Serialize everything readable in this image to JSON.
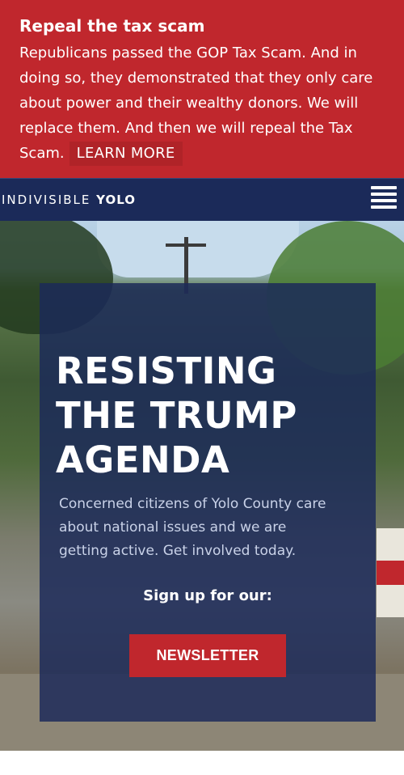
{
  "banner": {
    "title": "Repeal the tax scam",
    "body": "Republicans passed the GOP Tax Scam. And in doing so, they demonstrated that they only care about power and their wealthy donors. We will replace them. And then we will repeal the Tax Scam.",
    "learn_more": "LEARN MORE"
  },
  "nav": {
    "brand_part1": "INDIVISIBLE",
    "brand_part2": "YOLO",
    "menu_icon": "hamburger-menu-icon"
  },
  "hero": {
    "headline": "RESISTING THE TRUMP AGENDA",
    "description": "Concerned citizens of Yolo County care about national issues and we are getting active. Get involved today.",
    "signup_label": "Sign up for our:",
    "newsletter_button": "NEWSLETTER"
  },
  "colors": {
    "banner_red": "#c0272d",
    "navy": "#1b2a59"
  }
}
